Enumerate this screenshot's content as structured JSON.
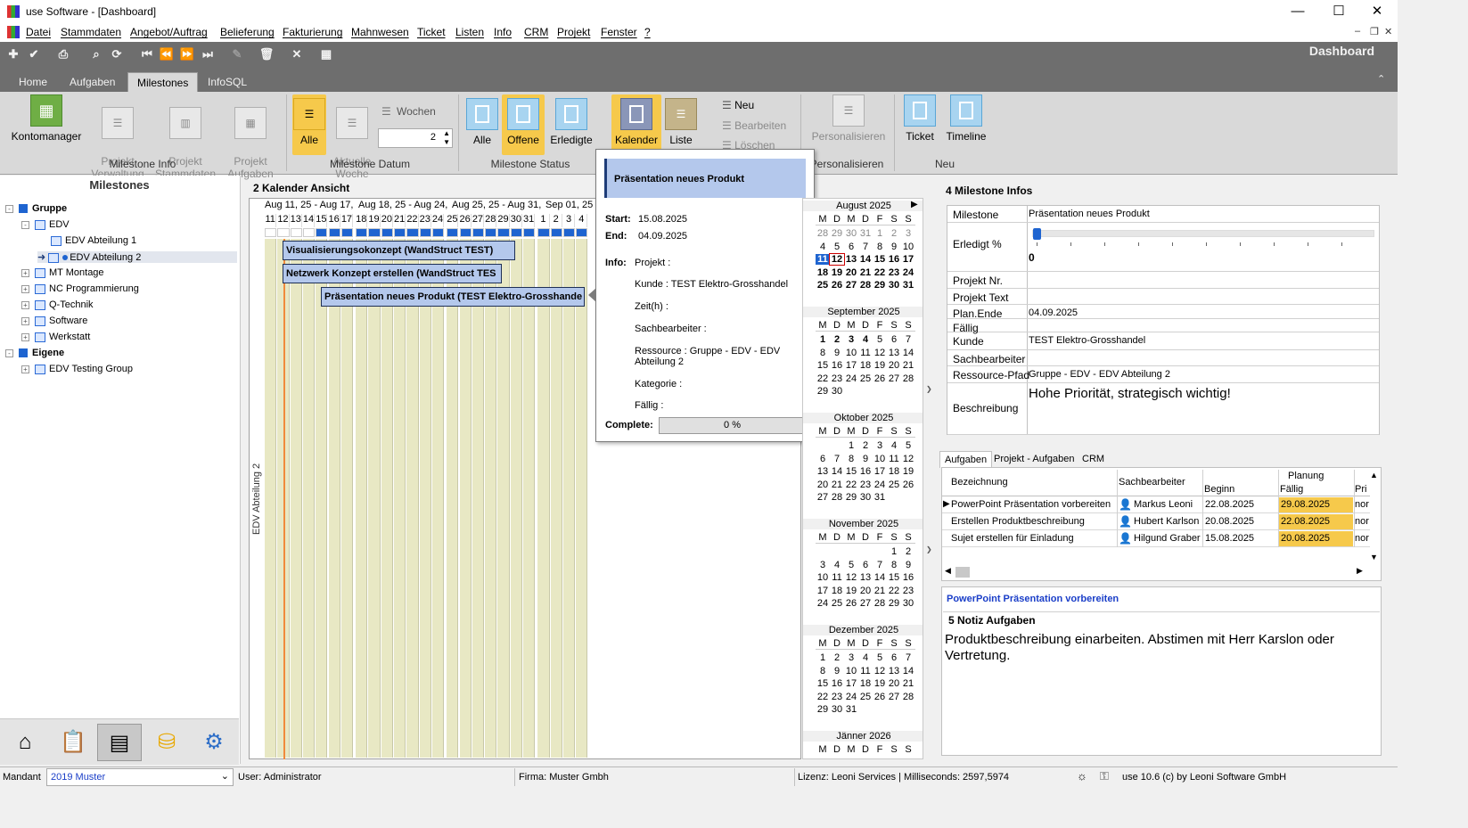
{
  "window": {
    "title": "use Software - [Dashboard]",
    "min": "—",
    "max": "☐",
    "close": "✕"
  },
  "menu": [
    "Datei",
    "Stammdaten",
    "Angebot/Auftrag",
    "Belieferung",
    "Fakturierung",
    "Mahnwesen",
    "Ticket",
    "Listen",
    "Info",
    "CRM",
    "Projekt",
    "Fenster",
    "?"
  ],
  "page_title": "Dashboard",
  "ribbon_tabs": [
    "Home",
    "Aufgaben",
    "Milestones",
    "InfoSQL"
  ],
  "ribbon": {
    "kontomanager": "Kontomanager",
    "projekt_verwaltung": "Projekt\nVerwaltung",
    "projekt_stammdaten": "Projekt\nStammdaten",
    "projekt_aufgaben": "Projekt\nAufgaben",
    "group_info": "Milestone Info",
    "alle": "Alle",
    "aktuelle_woche": "Aktuelle\nWoche",
    "wochen": "Wochen",
    "wochen_value": "2",
    "group_datum": "Milestone Datum",
    "status_alle": "Alle",
    "offene": "Offene",
    "erledigte": "Erledigte",
    "group_status": "Milestone Status",
    "kalender": "Kalender",
    "liste": "Liste",
    "neu": "Neu",
    "bearbeiten": "Bearbeiten",
    "loeschen": "Löschen",
    "personalisieren": "Personalisieren",
    "group_personalisieren": "Personalisieren",
    "ticket": "Ticket",
    "timeline": "Timeline",
    "group_neu": "Neu"
  },
  "left": {
    "header": "Milestones",
    "tree": [
      {
        "label": "Gruppe",
        "level": 0,
        "bold": true,
        "exp": "-"
      },
      {
        "label": "EDV",
        "level": 1,
        "exp": "-"
      },
      {
        "label": "EDV Abteilung 1",
        "level": 2
      },
      {
        "label": "EDV Abteilung 2",
        "level": 2,
        "selected": true
      },
      {
        "label": "MT Montage",
        "level": 1,
        "exp": "+"
      },
      {
        "label": "NC Programmierung",
        "level": 1,
        "exp": "+"
      },
      {
        "label": "Q-Technik",
        "level": 1,
        "exp": "+"
      },
      {
        "label": "Software",
        "level": 1,
        "exp": "+"
      },
      {
        "label": "Werkstatt",
        "level": 1,
        "exp": "+"
      },
      {
        "label": "Eigene",
        "level": 0,
        "bold": true,
        "exp": "-"
      },
      {
        "label": "EDV Testing Group",
        "level": 1,
        "exp": "+"
      }
    ]
  },
  "calendar": {
    "title": "2 Kalender Ansicht",
    "weeks": [
      "Aug 11, 25 - Aug 17,",
      "Aug 18, 25 - Aug 24,",
      "Aug 25, 25 - Aug 31,",
      "Sep 01, 25"
    ],
    "days": [
      "11",
      "12",
      "13",
      "14",
      "15",
      "16",
      "17",
      "18",
      "19",
      "20",
      "21",
      "22",
      "23",
      "24",
      "25",
      "26",
      "27",
      "28",
      "29",
      "30",
      "31",
      "1",
      "2",
      "3",
      "4"
    ],
    "resource": "EDV Abteilung 2",
    "tasks": [
      "Visualisierungsokonzept (WandStruct TEST)",
      "Netzwerk Konzept erstellen (WandStruct TES",
      "Präsentation neues Produkt (TEST Elektro-Grosshande"
    ]
  },
  "popup": {
    "title": "Präsentation neues Produkt",
    "start_label": "Start:",
    "start": "15.08.2025",
    "end_label": "End:",
    "end": "04.09.2025",
    "info_label": "Info:",
    "projekt": "Projekt :",
    "kunde": "Kunde : TEST Elektro-Grosshandel",
    "zeit": "Zeit(h) :",
    "sachbearbeiter": "Sachbearbeiter :",
    "ressource": "Ressource : Gruppe - EDV - EDV Abteilung 2",
    "kategorie": "Kategorie :",
    "faellig": "Fällig :",
    "complete_label": "Complete:",
    "complete": "0 %"
  },
  "minical": {
    "weekdays": [
      "M",
      "D",
      "M",
      "D",
      "F",
      "S",
      "S"
    ],
    "months": [
      {
        "title": "August 2025",
        "rows": [
          [
            "28",
            "29",
            "30",
            "31",
            "1",
            "2",
            "3"
          ],
          [
            "4",
            "5",
            "6",
            "7",
            "8",
            "9",
            "10"
          ],
          [
            "11",
            "12",
            "13",
            "14",
            "15",
            "16",
            "17"
          ],
          [
            "18",
            "19",
            "20",
            "21",
            "22",
            "23",
            "24"
          ],
          [
            "25",
            "26",
            "27",
            "28",
            "29",
            "30",
            "31"
          ]
        ]
      },
      {
        "title": "September 2025",
        "rows": [
          [
            "1",
            "2",
            "3",
            "4",
            "5",
            "6",
            "7"
          ],
          [
            "8",
            "9",
            "10",
            "11",
            "12",
            "13",
            "14"
          ],
          [
            "15",
            "16",
            "17",
            "18",
            "19",
            "20",
            "21"
          ],
          [
            "22",
            "23",
            "24",
            "25",
            "26",
            "27",
            "28"
          ],
          [
            "29",
            "30",
            "",
            "",
            "",
            "",
            ""
          ]
        ]
      },
      {
        "title": "Oktober 2025",
        "rows": [
          [
            "",
            "",
            "1",
            "2",
            "3",
            "4",
            "5"
          ],
          [
            "6",
            "7",
            "8",
            "9",
            "10",
            "11",
            "12"
          ],
          [
            "13",
            "14",
            "15",
            "16",
            "17",
            "18",
            "19"
          ],
          [
            "20",
            "21",
            "22",
            "23",
            "24",
            "25",
            "26"
          ],
          [
            "27",
            "28",
            "29",
            "30",
            "31",
            "",
            ""
          ]
        ]
      },
      {
        "title": "November 2025",
        "rows": [
          [
            "",
            "",
            "",
            "",
            "",
            "1",
            "2"
          ],
          [
            "3",
            "4",
            "5",
            "6",
            "7",
            "8",
            "9"
          ],
          [
            "10",
            "11",
            "12",
            "13",
            "14",
            "15",
            "16"
          ],
          [
            "17",
            "18",
            "19",
            "20",
            "21",
            "22",
            "23"
          ],
          [
            "24",
            "25",
            "26",
            "27",
            "28",
            "29",
            "30"
          ]
        ]
      },
      {
        "title": "Dezember 2025",
        "rows": [
          [
            "1",
            "2",
            "3",
            "4",
            "5",
            "6",
            "7"
          ],
          [
            "8",
            "9",
            "10",
            "11",
            "12",
            "13",
            "14"
          ],
          [
            "15",
            "16",
            "17",
            "18",
            "19",
            "20",
            "21"
          ],
          [
            "22",
            "23",
            "24",
            "25",
            "26",
            "27",
            "28"
          ],
          [
            "29",
            "30",
            "31",
            "",
            "",
            "",
            ""
          ]
        ]
      },
      {
        "title": "Jänner 2026",
        "rows": []
      }
    ]
  },
  "infos": {
    "title": "4 Milestone Infos",
    "rows": [
      {
        "k": "Milestone",
        "v": "Präsentation neues Produkt"
      },
      {
        "k": "Erledigt %",
        "v": "0"
      },
      {
        "k": "Projekt Nr.",
        "v": ""
      },
      {
        "k": "Projekt Text",
        "v": ""
      },
      {
        "k": "Plan.Ende",
        "v": "04.09.2025"
      },
      {
        "k": "Fällig",
        "v": ""
      },
      {
        "k": "Kunde",
        "v": "TEST Elektro-Grosshandel"
      },
      {
        "k": "Sachbearbeiter",
        "v": ""
      },
      {
        "k": "Ressource-Pfad",
        "v": "Gruppe - EDV - EDV Abteilung 2"
      },
      {
        "k": "Beschreibung",
        "v": "Hohe Priorität, strategisch wichtig!"
      }
    ],
    "erledigt_fraction": 0
  },
  "grid": {
    "tabs": [
      "Aufgaben",
      "Projekt - Aufgaben",
      "CRM"
    ],
    "headers": {
      "bez": "Bezeichnung",
      "sach": "Sachbearbeiter",
      "planung": "Planung",
      "beginn": "Beginn",
      "faellig": "Fällig",
      "prio": "Pri"
    },
    "rows": [
      {
        "bez": "PowerPoint Präsentation vorbereiten",
        "sach": "Markus Leoni",
        "beginn": "22.08.2025",
        "faellig": "29.08.2025",
        "prio": "nor"
      },
      {
        "bez": "Erstellen Produktbeschreibung",
        "sach": "Hubert Karlson",
        "beginn": "20.08.2025",
        "faellig": "22.08.2025",
        "prio": "nor"
      },
      {
        "bez": "Sujet erstellen für Einladung",
        "sach": "Hilgund Graber",
        "beginn": "15.08.2025",
        "faellig": "20.08.2025",
        "prio": "nor"
      }
    ]
  },
  "notiz": {
    "selected_task": "PowerPoint Präsentation vorbereiten",
    "title": "5 Notiz Aufgaben",
    "text": "Produktbeschreibung einarbeiten. Abstimen mit Herr Karslon oder Vertretung."
  },
  "status": {
    "mandant_label": "Mandant",
    "mandant": "2019 Muster",
    "user": "User: Administrator",
    "firma": "Firma: Muster Gmbh",
    "lizenz": "Lizenz: Leoni Services | Milliseconds: 2597,5974",
    "version": "use 10.6 (c) by Leoni Software GmbH"
  },
  "colors": {
    "accent_yellow": "#f6c94b",
    "task_blue": "#b4c8ec",
    "bar_blue": "#1e64d0",
    "toolbar_gray": "#6e6e6e"
  }
}
